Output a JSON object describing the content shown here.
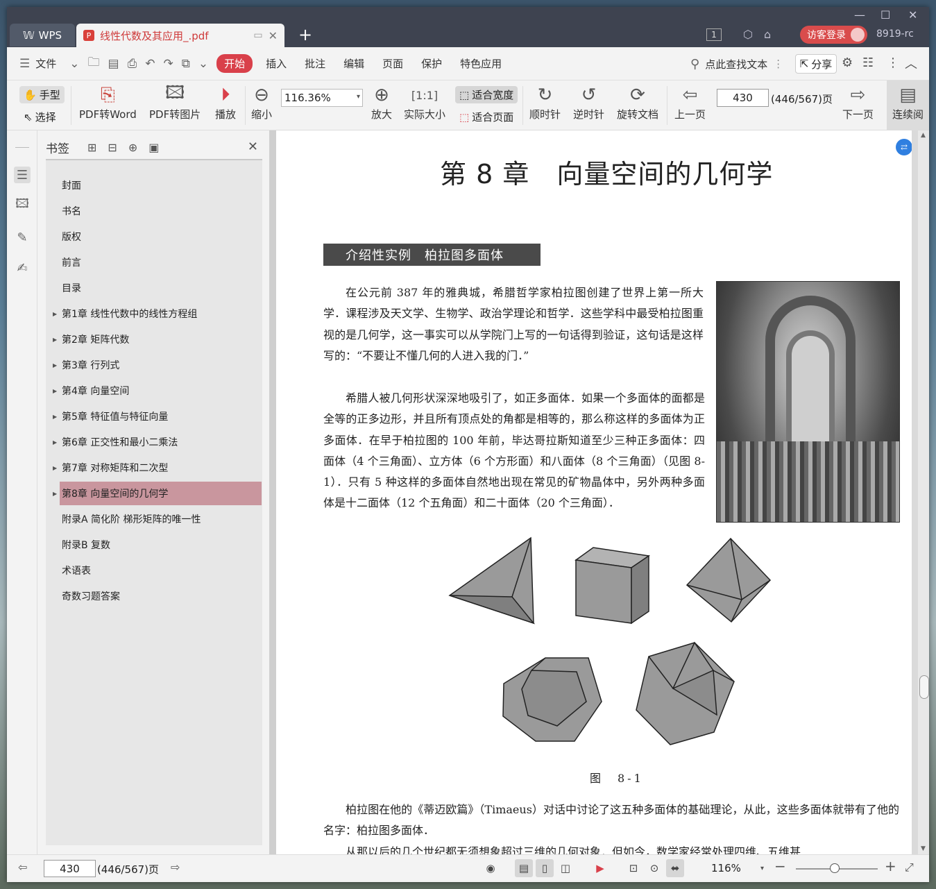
{
  "titlebar": {
    "app_tab": "WPS",
    "doc_tab": "线性代数及其应用_.pdf",
    "login_button": "访客登录",
    "user_code": "8919-rc",
    "page_badge": "1"
  },
  "menubar": {
    "file_label": "文件",
    "tabs": [
      "开始",
      "插入",
      "批注",
      "编辑",
      "页面",
      "保护",
      "特色应用"
    ],
    "search_hint": "点此查找文本",
    "share_label": "分享"
  },
  "toolbar": {
    "hand_tool": "手型",
    "select_tool": "选择",
    "pdf_to_word": "PDF转Word",
    "pdf_to_image": "PDF转图片",
    "play": "播放",
    "zoom_out": "缩小",
    "zoom_value": "116.36%",
    "zoom_in": "放大",
    "actual_size": "实际大小",
    "fit_width": "适合宽度",
    "fit_page": "适合页面",
    "clockwise": "顺时针",
    "counter_clockwise": "逆时针",
    "rotate_doc": "旋转文档",
    "prev_page": "上一页",
    "page_number": "430",
    "page_total": "(446/567)页",
    "next_page": "下一页",
    "continuous": "连续阅"
  },
  "sidebar": {
    "title": "书签",
    "items": [
      {
        "label": "封面",
        "expandable": false
      },
      {
        "label": "书名",
        "expandable": false
      },
      {
        "label": "版权",
        "expandable": false
      },
      {
        "label": "前言",
        "expandable": false
      },
      {
        "label": "目录",
        "expandable": false
      },
      {
        "label": "第1章 线性代数中的线性方程组",
        "expandable": true
      },
      {
        "label": "第2章 矩阵代数",
        "expandable": true
      },
      {
        "label": "第3章 行列式",
        "expandable": true
      },
      {
        "label": "第4章 向量空间",
        "expandable": true
      },
      {
        "label": "第5章 特征值与特征向量",
        "expandable": true
      },
      {
        "label": "第6章 正交性和最小二乘法",
        "expandable": true
      },
      {
        "label": "第7章 对称矩阵和二次型",
        "expandable": true
      },
      {
        "label": "第8章 向量空间的几何学",
        "expandable": true,
        "active": true
      },
      {
        "label": "附录A 简化阶 梯形矩阵的唯一性",
        "expandable": false
      },
      {
        "label": "附录B 复数",
        "expandable": false
      },
      {
        "label": "术语表",
        "expandable": false
      },
      {
        "label": "奇数习题答案",
        "expandable": false
      }
    ]
  },
  "page": {
    "chapter_title": "第 8 章　向量空间的几何学",
    "section_title": "介绍性实例　柏拉图多面体",
    "para1": "在公元前 387 年的雅典城，希腊哲学家柏拉图创建了世界上第一所大学．课程涉及天文学、生物学、政治学理论和哲学．这些学科中最受柏拉图重视的是几何学，这一事实可以从学院门上写的一句话得到验证，这句话是这样写的：“不要让不懂几何的人进入我的门．”",
    "para2": "希腊人被几何形状深深地吸引了，如正多面体．如果一个多面体的面都是全等的正多边形，并且所有顶点处的角都是相等的，那么称这样的多面体为正多面体．在早于柏拉图的 100 年前，毕达哥拉斯知道至少三种正多面体：四面体（4 个三角面）、立方体（6 个方形面）和八面体（8 个三角面）（见图 8-1）．只有 5 种这样的多面体自然地出现在常见的矿物晶体中，另外两种多面体是十二面体（12 个五角面）和二十面体（20 个三角面）．",
    "figure_caption": "图　8-1",
    "para3": "柏拉图在他的《蒂迈欧篇》（Timaeus）对话中讨论了这五种多面体的基础理论，从此，这些多面体就带有了他的名字：柏拉图多面体．",
    "para4": "从那以后的几个世纪都无须想象超过三维的几何对象．但如今，数学家经常处理四维、五维甚"
  },
  "statusbar": {
    "page_number": "430",
    "page_total": "(446/567)页",
    "zoom": "116%"
  },
  "colors": {
    "accent": "#d9404a",
    "active_bookmark": "#c9969e",
    "titlebar": "#3e4350"
  }
}
